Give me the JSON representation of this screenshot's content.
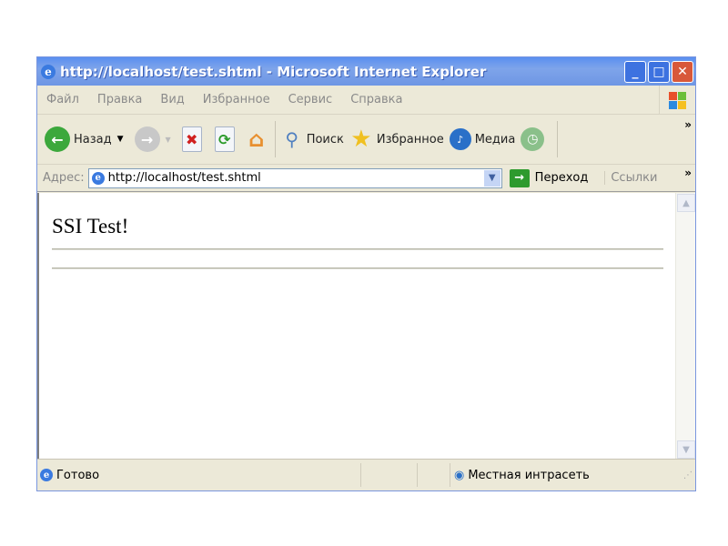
{
  "window": {
    "title": "http://localhost/test.shtml - Microsoft Internet Explorer"
  },
  "menu": [
    "Файл",
    "Правка",
    "Вид",
    "Избранное",
    "Сервис",
    "Справка"
  ],
  "toolbar": {
    "back": "Назад",
    "search": "Поиск",
    "favorites": "Избранное",
    "media": "Медиа",
    "more": "»"
  },
  "address": {
    "label": "Адрес:",
    "url": "http://localhost/test.shtml",
    "go": "Переход",
    "links": "Ссылки",
    "more": "»"
  },
  "page": {
    "heading": "SSI Test!"
  },
  "status": {
    "text": "Готово",
    "zone": "Местная интрасеть"
  }
}
